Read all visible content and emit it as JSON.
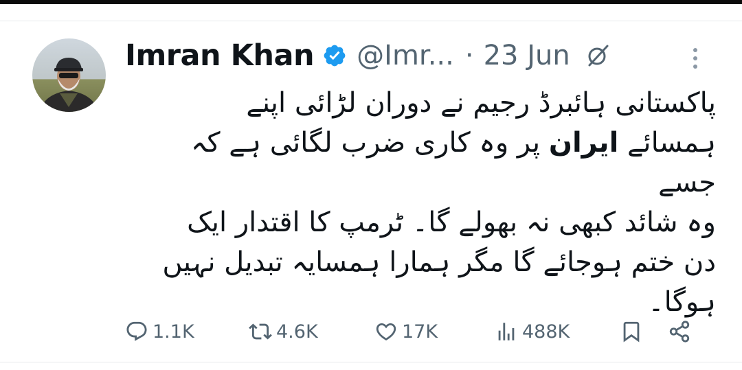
{
  "tweet": {
    "author_name": "Imran Khan",
    "handle": "@Imr...",
    "separator": "·",
    "date": "23 Jun",
    "text_line_1": "پاکستانی ہائبرڈ رجیم نے دوران لڑائی اپنے",
    "text_line_2_before": "ہمسائے ",
    "text_line_2_bold": "ایران",
    "text_line_2_after": " پر وہ کاری ضرب لگائی ہے کہ جسے",
    "text_line_3": "وہ شائد کبھی نہ بھولے گا۔ ٹرمپ کا اقتدار ایک",
    "text_line_4": "دن ختم ہوجائے گا مگر ہمارا ہمسایہ تبدیل نہیں",
    "text_line_5": "ہوگا۔"
  },
  "actions": {
    "replies": "1.1K",
    "reposts": "4.6K",
    "likes": "17K",
    "views": "488K"
  },
  "icons": {
    "verified": "verified-badge-icon",
    "grok": "grok-icon",
    "more": "more-options-icon",
    "reply": "reply-icon",
    "repost": "repost-icon",
    "like": "heart-icon",
    "views": "views-chart-icon",
    "bookmark": "bookmark-icon",
    "share": "share-icon"
  },
  "colors": {
    "text_primary": "#0f1419",
    "text_secondary": "#536471",
    "verified_blue": "#1d9bf0",
    "divider": "#e6e9ec"
  }
}
